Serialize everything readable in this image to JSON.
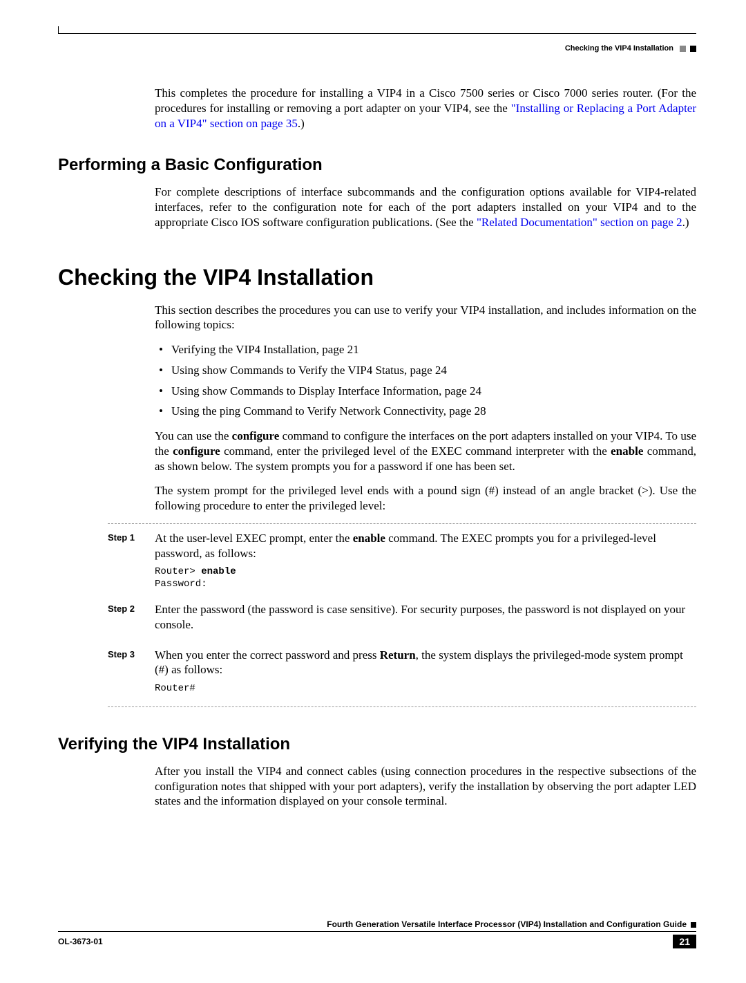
{
  "header": {
    "label": "Checking the VIP4 Installation"
  },
  "intro": {
    "lead": "This completes the procedure for installing a VIP4 in a Cisco 7500 series or Cisco 7000 series router. (For the procedures for installing or removing a port adapter on your VIP4, see the ",
    "link": "\"Installing or Replacing a Port Adapter on a VIP4\" section on page 35",
    "tail": ".)"
  },
  "performing": {
    "title": "Performing a Basic Configuration",
    "body_lead": "For complete descriptions of interface subcommands and the configuration options available for VIP4-related interfaces, refer to the configuration note for each of the port adapters installed on your VIP4 and to the appropriate Cisco IOS software configuration publications. (See the ",
    "link": "\"Related Documentation\" section on page 2",
    "tail": ".)"
  },
  "checking": {
    "title": "Checking the VIP4 Installation",
    "intro": "This section describes the procedures you can use to verify your VIP4 installation, and includes information on the following topics:",
    "bullets": [
      "Verifying the VIP4 Installation, page 21",
      "Using show Commands to Verify the VIP4 Status, page 24",
      "Using show Commands to Display Interface Information, page 24",
      "Using the ping Command to Verify Network Connectivity, page 28"
    ],
    "para1_a": "You can use the ",
    "para1_b": "configure",
    "para1_c": " command to configure the interfaces on the port adapters installed on your VIP4. To use the ",
    "para1_d": "configure",
    "para1_e": " command, enter the privileged level of the EXEC command interpreter with the ",
    "para1_f": "enable",
    "para1_g": " command, as shown below. The system prompts you for a password if one has been set.",
    "para2": "The system prompt for the privileged level ends with a pound sign (#) instead of an angle bracket (>). Use the following procedure to enter the privileged level:"
  },
  "steps": [
    {
      "label": "Step 1",
      "text_a": "At the user-level EXEC prompt, enter the ",
      "bold": "enable",
      "text_b": " command. The EXEC prompts you for a privileged-level password, as follows:",
      "code_prompt": "Router> ",
      "code_kw": "enable",
      "code_line2": "Password:"
    },
    {
      "label": "Step 2",
      "text_a": "Enter the password (the password is case sensitive). For security purposes, the password is not displayed on your console.",
      "bold": "",
      "text_b": "",
      "code_prompt": "",
      "code_kw": "",
      "code_line2": ""
    },
    {
      "label": "Step 3",
      "text_a": "When you enter the correct password and press ",
      "bold": "Return",
      "text_b": ", the system displays the privileged-mode system prompt (#) as follows:",
      "code_prompt": "Router#",
      "code_kw": "",
      "code_line2": ""
    }
  ],
  "verifying": {
    "title": "Verifying the VIP4 Installation",
    "body": "After you install the VIP4 and connect cables (using connection procedures in the respective subsections of the configuration notes that shipped with your port adapters), verify the installation by observing the port adapter LED states and the information displayed on your console terminal."
  },
  "footer": {
    "doc_title": "Fourth Generation Versatile Interface Processor (VIP4) Installation and Configuration Guide",
    "doc_id": "OL-3673-01",
    "page_num": "21"
  }
}
